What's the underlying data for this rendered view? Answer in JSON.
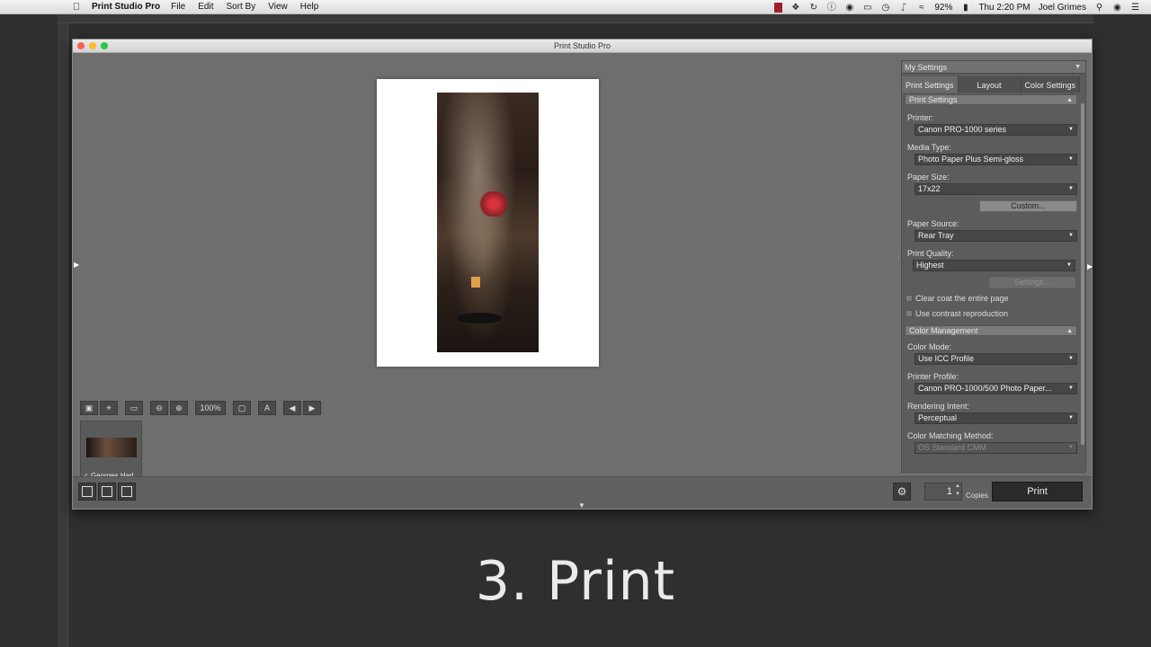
{
  "menubar": {
    "app_name": "Print Studio Pro",
    "items": [
      "File",
      "Edit",
      "Sort By",
      "View",
      "Help"
    ],
    "battery": "92%",
    "clock": "Thu 2:20 PM",
    "user": "Joel Grimes"
  },
  "window": {
    "title": "Print Studio Pro"
  },
  "toolbar": {
    "zoom_value": "100%"
  },
  "thumbnail": {
    "label": "Georges Harl..."
  },
  "panel": {
    "settings_preset": "My Settings",
    "tabs": [
      "Print Settings",
      "Layout",
      "Color Settings"
    ],
    "print_settings_header": "Print Settings",
    "printer_label": "Printer:",
    "printer_value": "Canon PRO-1000 series",
    "media_label": "Media Type:",
    "media_value": "Photo Paper Plus Semi-gloss",
    "paper_size_label": "Paper Size:",
    "paper_size_value": "17x22",
    "custom_button": "Custom...",
    "paper_source_label": "Paper Source:",
    "paper_source_value": "Rear Tray",
    "quality_label": "Print Quality:",
    "quality_value": "Highest",
    "settings_button": "Settings...",
    "clear_coat_label": "Clear coat the entire page",
    "contrast_label": "Use contrast reproduction",
    "color_mgmt_header": "Color Management",
    "color_mode_label": "Color Mode:",
    "color_mode_value": "Use ICC Profile",
    "printer_profile_label": "Printer Profile:",
    "printer_profile_value": "Canon PRO-1000/500 Photo Paper...",
    "rendering_label": "Rendering Intent:",
    "rendering_value": "Perceptual",
    "matching_label": "Color Matching Method:",
    "matching_value": "OS Standard CMM"
  },
  "bottombar": {
    "copies_value": "1",
    "copies_label": "Copies",
    "print_button": "Print"
  },
  "caption": "3. Print"
}
